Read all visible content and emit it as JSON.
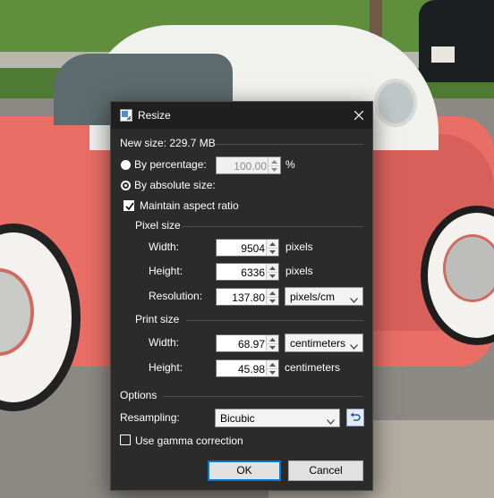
{
  "dialog": {
    "title": "Resize",
    "new_size": "New size: 229.7 MB",
    "by_percentage_label": "By percentage:",
    "percentage_value": "100.00",
    "percent_unit": "%",
    "by_absolute_label": "By absolute size:",
    "maintain_aspect_label": "Maintain aspect ratio",
    "maintain_aspect_checked": true,
    "selected_mode": "absolute",
    "pixel_size_heading": "Pixel size",
    "pixel": {
      "width_label": "Width:",
      "width_value": "9504",
      "width_unit": "pixels",
      "height_label": "Height:",
      "height_value": "6336",
      "height_unit": "pixels",
      "resolution_label": "Resolution:",
      "resolution_value": "137.80",
      "resolution_unit": "pixels/cm"
    },
    "print_size_heading": "Print size",
    "print": {
      "width_label": "Width:",
      "width_value": "68.97",
      "width_unit": "centimeters",
      "height_label": "Height:",
      "height_value": "45.98",
      "height_unit": "centimeters"
    },
    "options_heading": "Options",
    "resampling_label": "Resampling:",
    "resampling_value": "Bicubic",
    "gamma_label": "Use gamma correction",
    "gamma_checked": false,
    "ok_label": "OK",
    "cancel_label": "Cancel"
  },
  "colors": {
    "dialog_bg": "#2b2b2b",
    "titlebar_bg": "#1f1f1f",
    "accent": "#0078d7"
  }
}
